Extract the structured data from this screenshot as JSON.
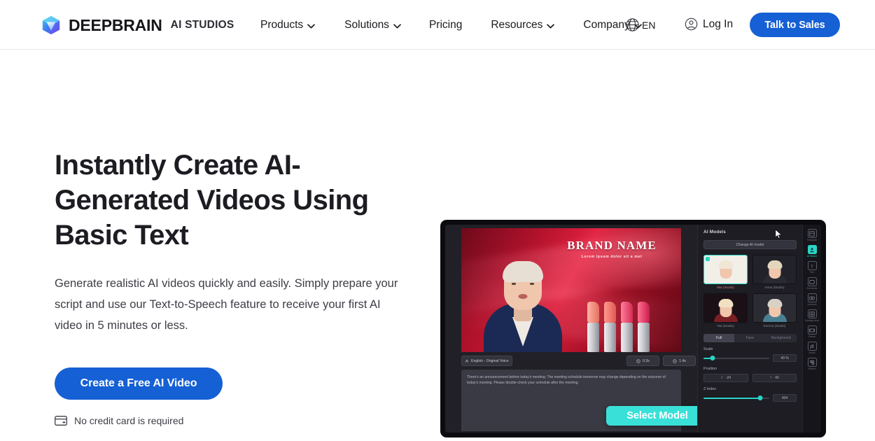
{
  "colors": {
    "brand_blue": "#1560d4",
    "accent_teal": "#39e0d8",
    "panel_dark": "#1d1d23",
    "text_dark": "#1c1c22"
  },
  "header": {
    "logo_icon": "cube-logo-icon",
    "brand_name": "DEEPBRAIN",
    "brand_sub": "AI STUDIOS",
    "nav_items": [
      {
        "label": "Products",
        "has_dropdown": true,
        "chevron_icon": "chevron-down-icon"
      },
      {
        "label": "Solutions",
        "has_dropdown": true,
        "chevron_icon": "chevron-down-icon"
      },
      {
        "label": "Pricing",
        "has_dropdown": false
      },
      {
        "label": "Resources",
        "has_dropdown": true,
        "chevron_icon": "chevron-down-icon"
      },
      {
        "label": "Company",
        "has_dropdown": true,
        "chevron_icon": "chevron-down-icon"
      }
    ],
    "language": {
      "code": "EN",
      "globe_icon": "globe-icon",
      "chevron_icon": "chevron-down-icon"
    },
    "login": {
      "label": "Log In",
      "icon": "user-circle-icon"
    },
    "cta": {
      "label": "Talk to Sales"
    }
  },
  "hero": {
    "headline": "Instantly Create AI-Generated Videos Using Basic Text",
    "subtext": "Generate realistic AI videos quickly and easily. Simply prepare your script and use our Text-to-Speech feature to receive your first AI video in 5 minutes or less.",
    "cta_label": "Create a Free AI Video",
    "note": "No credit card is required",
    "note_icon": "credit-card-icon"
  },
  "mock": {
    "video": {
      "brand_title": "BRAND NAME",
      "brand_sub": "Lorem ipsum dolor sit a met"
    },
    "toolbar": {
      "language_chip": "English - Original Voice",
      "language_chip_icon": "voice-icon",
      "duration_1": "0.3s",
      "duration_2": "1.4s",
      "duration_icon": "clock-icon"
    },
    "script": {
      "text": "There's an announcement before today's meeting. The meeting schedule tomorrow may change depending on the outcome of today's meeting. Please double-check your schedule after the meeting."
    },
    "select_model_button": "Select Model",
    "panel": {
      "title": "AI Models",
      "change_model_button": "Change AI model",
      "models": [
        {
          "label": "Mia (Studio)",
          "selected": true,
          "hair": "#efe6d6",
          "body": "#f2efe9"
        },
        {
          "label": "Anna (Studio)",
          "selected": false,
          "hair": "#e4d6bd",
          "body": "#2a2a33"
        },
        {
          "label": "Nia (Studio)",
          "selected": false,
          "hair": "#f2e0c2",
          "body": "#7a1f24"
        },
        {
          "label": "Serena (Studio)",
          "selected": false,
          "hair": "#d8d2c6",
          "body": "#4a7f92"
        }
      ],
      "segments": [
        {
          "label": "Full",
          "active": true
        },
        {
          "label": "Face",
          "active": false
        },
        {
          "label": "Background",
          "active": false
        }
      ],
      "scale": {
        "label": "Scale",
        "value": "40 %",
        "percent": 14
      },
      "position": {
        "label": "Position",
        "x_axis": "X",
        "x_value": "-24",
        "y_axis": "Y",
        "y_value": "40"
      },
      "z_index": {
        "label": "Z Index",
        "value": "404",
        "percent": 86
      }
    },
    "vertical_toolbar": [
      {
        "label": "Template",
        "icon": "template-icon",
        "active": false
      },
      {
        "label": "AI Model",
        "icon": "ai-model-icon",
        "active": true
      },
      {
        "label": "Text",
        "icon": "text-icon",
        "active": false
      },
      {
        "label": "Elements",
        "icon": "elements-icon",
        "active": false
      },
      {
        "label": "Account",
        "icon": "account-icon",
        "active": false
      },
      {
        "label": "Background",
        "icon": "background-icon",
        "active": false
      },
      {
        "label": "Frame",
        "icon": "frame-icon",
        "active": false
      },
      {
        "label": "Audio",
        "icon": "audio-icon",
        "active": false
      },
      {
        "label": "Effects",
        "icon": "effects-icon",
        "active": false
      }
    ],
    "cursor_icon": "mouse-cursor-icon"
  }
}
